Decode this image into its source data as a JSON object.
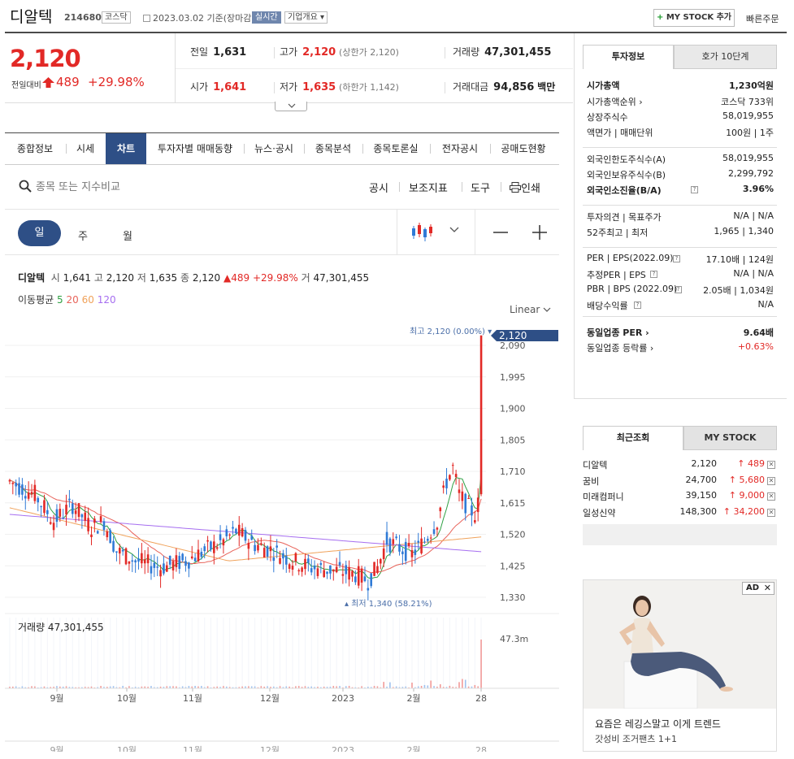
{
  "header": {
    "stock_name": "디알텍",
    "stock_code": "214680",
    "market": "코스닥",
    "date_text": "2023.03.02  기준(장마감)",
    "realtime": "실시간",
    "company_overview": "기업개요 ▾",
    "mystock_add": "MY STOCK 추가",
    "mystock_plus": "+",
    "quick_order": "빠른주문"
  },
  "price": {
    "current": "2,120",
    "change_label": "전일대비",
    "change_amount": "489",
    "change_percent": "+29.98%"
  },
  "info": {
    "prev_label": "전일",
    "prev_value": "1,631",
    "high_label": "고가",
    "high_value": "2,120",
    "high_sub": "(상한가 2,120)",
    "volume_label": "거래량",
    "volume_value": "47,301,455",
    "open_label": "시가",
    "open_value": "1,641",
    "low_label": "저가",
    "low_value": "1,635",
    "low_sub": "(하한가 1,142)",
    "amount_label": "거래대금",
    "amount_value": "94,856",
    "amount_unit": "백만"
  },
  "right_panel": {
    "tab_invest": "투자정보",
    "tab_hoga": "호가 10단계",
    "rows": [
      {
        "l": "시가총액",
        "r": "1,230억원",
        "bold": true
      },
      {
        "l": "시가총액순위 ›",
        "r": "코스닥 733위"
      },
      {
        "l": "상장주식수",
        "r": "58,019,955"
      },
      {
        "l": "액면가 | 매매단위",
        "r": "100원 | 1주"
      },
      {
        "l": "외국인한도주식수(A)",
        "r": "58,019,955"
      },
      {
        "l": "외국인보유주식수(B)",
        "r": "2,299,792"
      },
      {
        "l": "외국인소진율(B/A)",
        "r": "3.96%",
        "bold": true
      },
      {
        "l": "투자의견 | 목표주가",
        "r": "N/A | N/A"
      },
      {
        "l": "52주최고 | 최저",
        "r": "1,965 | 1,340"
      },
      {
        "l": "PER | EPS(2022.09)",
        "r": "17.10배 | 124원"
      },
      {
        "l": "추정PER | EPS",
        "r": "N/A | N/A"
      },
      {
        "l": "PBR | BPS (2022.09)",
        "r": "2.05배 | 1,034원"
      },
      {
        "l": "배당수익률",
        "r": "N/A"
      },
      {
        "l": "동일업종 PER ›",
        "r": "9.64배",
        "bold": true
      },
      {
        "l": "동일업종 등락률 ›",
        "r": "+0.63%",
        "red": true
      }
    ]
  },
  "recent": {
    "tab_recent": "최근조회",
    "tab_mystock": "MY STOCK",
    "items": [
      {
        "name": "디알텍",
        "price": "2,120",
        "change": "↑ 489"
      },
      {
        "name": "꿈비",
        "price": "24,700",
        "change": "↑ 5,680"
      },
      {
        "name": "미래컴퍼니",
        "price": "39,150",
        "change": "↑ 9,000"
      },
      {
        "name": "일성신약",
        "price": "148,300",
        "change": "↑ 34,200"
      }
    ]
  },
  "ad": {
    "badge": "AD",
    "title": "요즘은 레깅스말고 이게 트렌드",
    "subtitle": "갓성비 조거팬츠 1+1"
  },
  "tabs": [
    "종합정보",
    "시세",
    "차트",
    "투자자별 매매동향",
    "뉴스·공시",
    "종목분석",
    "종목토론실",
    "전자공시",
    "공매도현황"
  ],
  "search": {
    "placeholder": "종목 또는 지수비교"
  },
  "tools": [
    "공시",
    "보조지표",
    "도구",
    "인쇄"
  ],
  "periods": {
    "day": "일",
    "week": "주",
    "month": "월"
  },
  "ohlc": {
    "name": "디알텍",
    "open_k": "시",
    "open": "1,641",
    "high_k": "고",
    "high": "2,120",
    "low_k": "저",
    "low": "1,635",
    "close_k": "종",
    "close": "2,120",
    "chg": "▲489 +29.98%",
    "vol_k": "거",
    "vol": "47,301,455"
  },
  "ma": {
    "label": "이동평균",
    "p5": "5",
    "p20": "20",
    "p60": "60",
    "p120": "120"
  },
  "scale": "Linear",
  "chart_data": {
    "type": "candlestick",
    "yticks": [
      "2,090",
      "1,995",
      "1,900",
      "1,805",
      "1,710",
      "1,615",
      "1,520",
      "1,425",
      "1,330"
    ],
    "xticks": [
      "9월",
      "10월",
      "11월",
      "12월",
      "2023",
      "2월",
      "28"
    ],
    "last_price_label": "2,120",
    "max_label": "최고 2,120 (0.00%)",
    "min_label": "최저 1,340 (58.21%)",
    "volume_label": "거래량 47,301,455",
    "volume_max_label": "47.3m",
    "colors": {
      "up": "#e22926",
      "down": "#2f7ad6",
      "ma5": "#2ea043",
      "ma20": "#e8635a",
      "ma60": "#f0a25a",
      "ma120": "#a66ef0"
    }
  }
}
